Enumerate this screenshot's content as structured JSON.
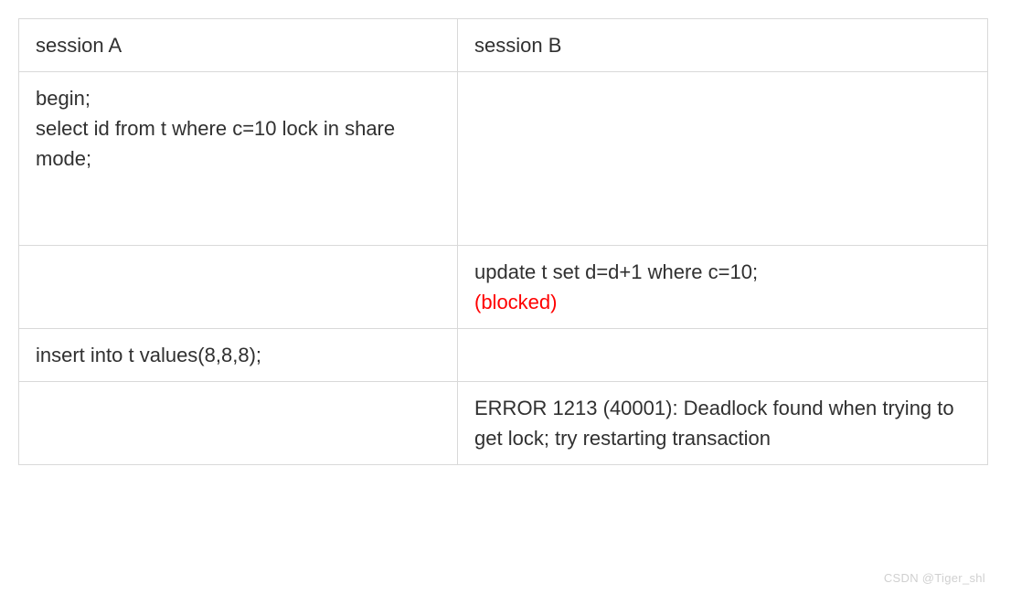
{
  "table": {
    "headers": {
      "col_a": "session A",
      "col_b": "session B"
    },
    "rows": [
      {
        "a_line1": "begin;",
        "a_line2": "select id from t where c=10 lock in share mode;",
        "b": ""
      },
      {
        "a": "",
        "b_line1": "update t set d=d+1 where c=10;",
        "b_line2": "(blocked)"
      },
      {
        "a": "insert into t values(8,8,8);",
        "b": ""
      },
      {
        "a": "",
        "b": "ERROR 1213 (40001): Deadlock found when trying to get lock; try restarting transaction"
      }
    ]
  },
  "watermark": "CSDN @Tiger_shl"
}
